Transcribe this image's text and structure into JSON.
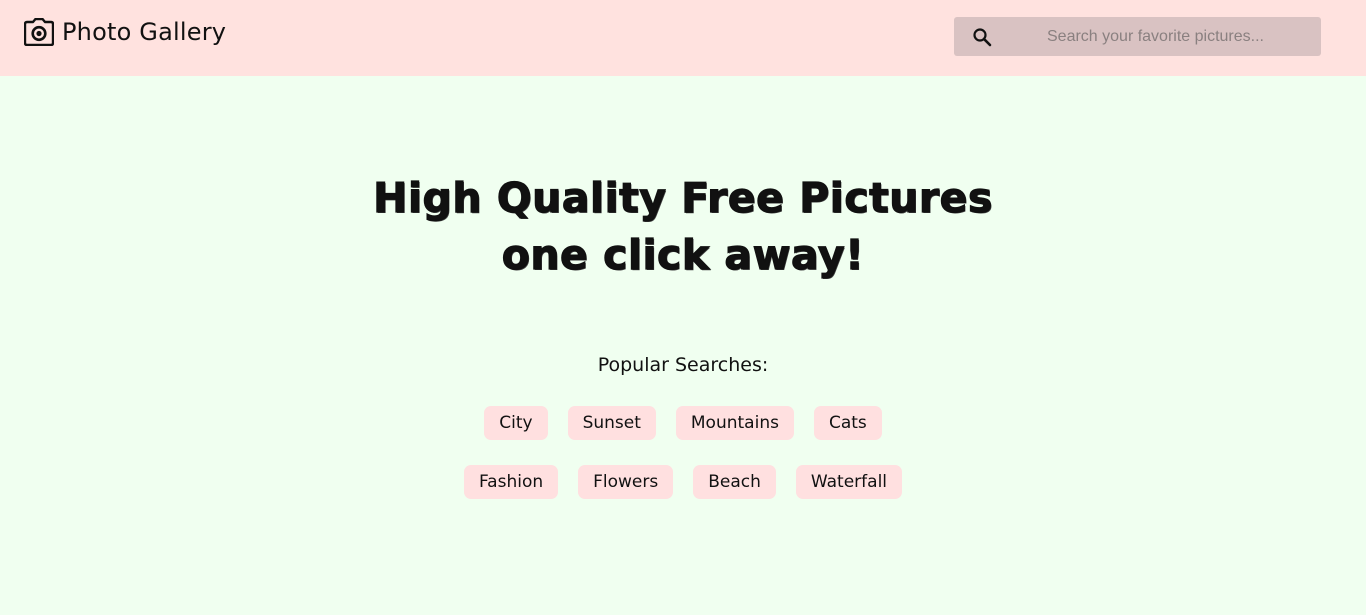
{
  "header": {
    "title": "Photo Gallery",
    "search": {
      "value": "",
      "placeholder": "Search your favorite pictures..."
    }
  },
  "hero": {
    "line1": "High Quality Free Pictures",
    "line2": "one click away!"
  },
  "popular": {
    "label": "Popular Searches:",
    "row1": [
      "City",
      "Sunset",
      "Mountains",
      "Cats"
    ],
    "row2": [
      "Fashion",
      "Flowers",
      "Beach",
      "Waterfall"
    ]
  },
  "colors": {
    "header_bg": "#ffe2df",
    "page_bg": "#f0fff0",
    "search_bg": "#d9c2c2",
    "tag_bg": "#ffe0e0"
  },
  "icons": {
    "brand": "camera-icon",
    "search": "search-icon"
  }
}
